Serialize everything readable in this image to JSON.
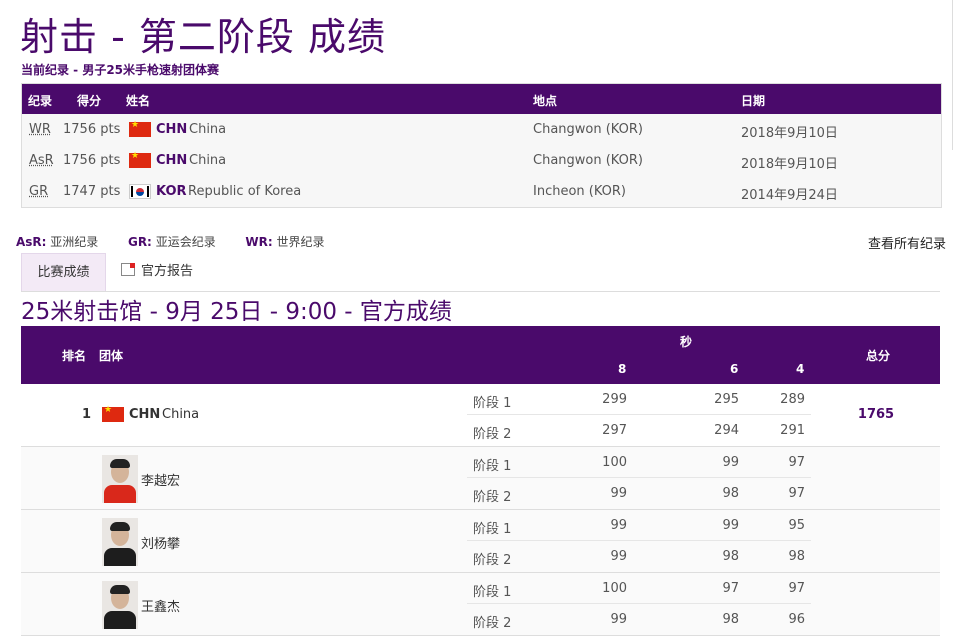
{
  "page": {
    "title": "射击 - 第二阶段 成绩",
    "subtitle": "当前纪录 - 男子25米手枪速射团体赛"
  },
  "records": {
    "headers": {
      "code": "纪录",
      "score": "得分",
      "name": "姓名",
      "place": "地点",
      "date": "日期"
    },
    "rows": [
      {
        "code": "WR",
        "score": "1756 pts",
        "noc": "CHN",
        "country": "China",
        "flag": "flag-china",
        "place": "Changwon (KOR)",
        "date": "2018年9月10日"
      },
      {
        "code": "AsR",
        "score": "1756 pts",
        "noc": "CHN",
        "country": "China",
        "flag": "flag-china",
        "place": "Changwon (KOR)",
        "date": "2018年9月10日"
      },
      {
        "code": "GR",
        "score": "1747 pts",
        "noc": "KOR",
        "country": "Republic of Korea",
        "flag": "flag-korea",
        "place": "Incheon (KOR)",
        "date": "2014年9月24日"
      }
    ]
  },
  "legend": {
    "asr_key": "AsR:",
    "asr_label": "亚洲纪录",
    "gr_key": "GR:",
    "gr_label": "亚运会纪录",
    "wr_key": "WR:",
    "wr_label": "世界纪录",
    "view_all": "查看所有纪录"
  },
  "tabs": {
    "results": "比赛成绩",
    "report": "官方报告"
  },
  "event_title": "25米射击馆 - 9月 25日 - 9:00 - 官方成绩",
  "results": {
    "headers": {
      "rank": "排名",
      "team": "团体",
      "seconds": "秒",
      "s8": "8",
      "s6": "6",
      "s4": "4",
      "total": "总分"
    },
    "team": {
      "rank": "1",
      "noc": "CHN",
      "country": "China",
      "flag": "flag-china",
      "total": "1765",
      "stages": [
        {
          "label": "阶段 1",
          "s8": "299",
          "s6": "295",
          "s4": "289"
        },
        {
          "label": "阶段 2",
          "s8": "297",
          "s6": "294",
          "s4": "291"
        }
      ]
    },
    "athletes": [
      {
        "name": "李越宏",
        "stages": [
          {
            "label": "阶段 1",
            "s8": "100",
            "s6": "99",
            "s4": "97"
          },
          {
            "label": "阶段 2",
            "s8": "99",
            "s6": "98",
            "s4": "97"
          }
        ]
      },
      {
        "name": "刘杨攀",
        "stages": [
          {
            "label": "阶段 1",
            "s8": "99",
            "s6": "99",
            "s4": "95"
          },
          {
            "label": "阶段 2",
            "s8": "99",
            "s6": "98",
            "s4": "98"
          }
        ]
      },
      {
        "name": "王鑫杰",
        "stages": [
          {
            "label": "阶段 1",
            "s8": "100",
            "s6": "97",
            "s4": "97"
          },
          {
            "label": "阶段 2",
            "s8": "99",
            "s6": "98",
            "s4": "96"
          }
        ]
      }
    ]
  },
  "colors": {
    "brand": "#4a0a6b",
    "tab_active_bg": "#f3eaf6"
  }
}
